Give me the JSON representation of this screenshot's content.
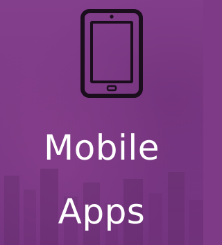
{
  "tile": {
    "line1": "Mobile",
    "line2": "Apps",
    "icon": "tablet-icon"
  },
  "colors": {
    "background": "#7e3a86",
    "icon_stroke": "#1a0d1c",
    "text": "#ffffff"
  }
}
